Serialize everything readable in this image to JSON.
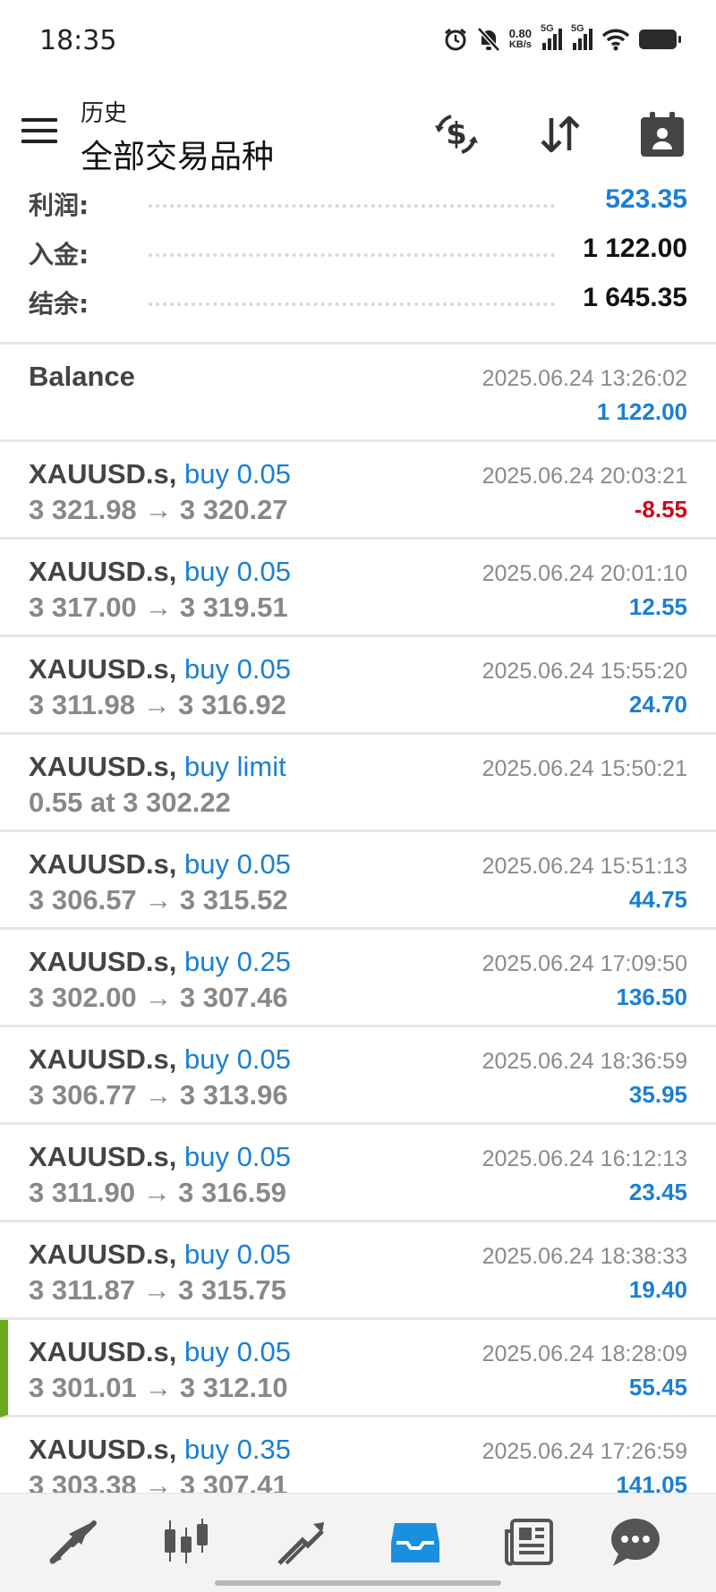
{
  "status": {
    "time": "18:35",
    "net_speed_value": "0.80",
    "net_speed_unit": "KB/s",
    "signal1": "5G",
    "signal2": "5G"
  },
  "header": {
    "subtitle": "历史",
    "title": "全部交易品种"
  },
  "summary": {
    "profit_label": "利润:",
    "profit_value": "523.35",
    "deposit_label": "入金:",
    "deposit_value": "1 122.00",
    "balance_label": "结余:",
    "balance_value": "1 645.35"
  },
  "balance_entry": {
    "label": "Balance",
    "time": "2025.06.24 13:26:02",
    "amount": "1 122.00"
  },
  "trades": [
    {
      "symbol": "XAUUSD.s,",
      "type": "buy 0.05",
      "prices": "3 321.98 → 3 320.27",
      "time": "2025.06.24 20:03:21",
      "profit": "-8.55"
    },
    {
      "symbol": "XAUUSD.s,",
      "type": "buy 0.05",
      "prices": "3 317.00 → 3 319.51",
      "time": "2025.06.24 20:01:10",
      "profit": "12.55"
    },
    {
      "symbol": "XAUUSD.s,",
      "type": "buy 0.05",
      "prices": "3 311.98 → 3 316.92",
      "time": "2025.06.24 15:55:20",
      "profit": "24.70"
    },
    {
      "symbol": "XAUUSD.s,",
      "type": "buy limit",
      "prices": "0.55 at 3 302.22",
      "time": "2025.06.24 15:50:21",
      "profit": ""
    },
    {
      "symbol": "XAUUSD.s,",
      "type": "buy 0.05",
      "prices": "3 306.57 → 3 315.52",
      "time": "2025.06.24 15:51:13",
      "profit": "44.75"
    },
    {
      "symbol": "XAUUSD.s,",
      "type": "buy 0.25",
      "prices": "3 302.00 → 3 307.46",
      "time": "2025.06.24 17:09:50",
      "profit": "136.50"
    },
    {
      "symbol": "XAUUSD.s,",
      "type": "buy 0.05",
      "prices": "3 306.77 → 3 313.96",
      "time": "2025.06.24 18:36:59",
      "profit": "35.95"
    },
    {
      "symbol": "XAUUSD.s,",
      "type": "buy 0.05",
      "prices": "3 311.90 → 3 316.59",
      "time": "2025.06.24 16:12:13",
      "profit": "23.45"
    },
    {
      "symbol": "XAUUSD.s,",
      "type": "buy 0.05",
      "prices": "3 311.87 → 3 315.75",
      "time": "2025.06.24 18:38:33",
      "profit": "19.40"
    },
    {
      "symbol": "XAUUSD.s,",
      "type": "buy 0.05",
      "prices": "3 301.01 → 3 312.10",
      "time": "2025.06.24 18:28:09",
      "profit": "55.45"
    },
    {
      "symbol": "XAUUSD.s,",
      "type": "buy 0.35",
      "prices": "3 303.38 → 3 307.41",
      "time": "2025.06.24 17:26:59",
      "profit": "141.05"
    }
  ],
  "nav": [
    "quotes-icon",
    "chart-icon",
    "trade-icon",
    "history-icon",
    "news-icon",
    "chat-icon"
  ],
  "colors": {
    "accent": "#1a7fd4",
    "negative": "#d0021b",
    "selected_bar": "#6aa820",
    "active_tab": "#1a8fe0"
  }
}
